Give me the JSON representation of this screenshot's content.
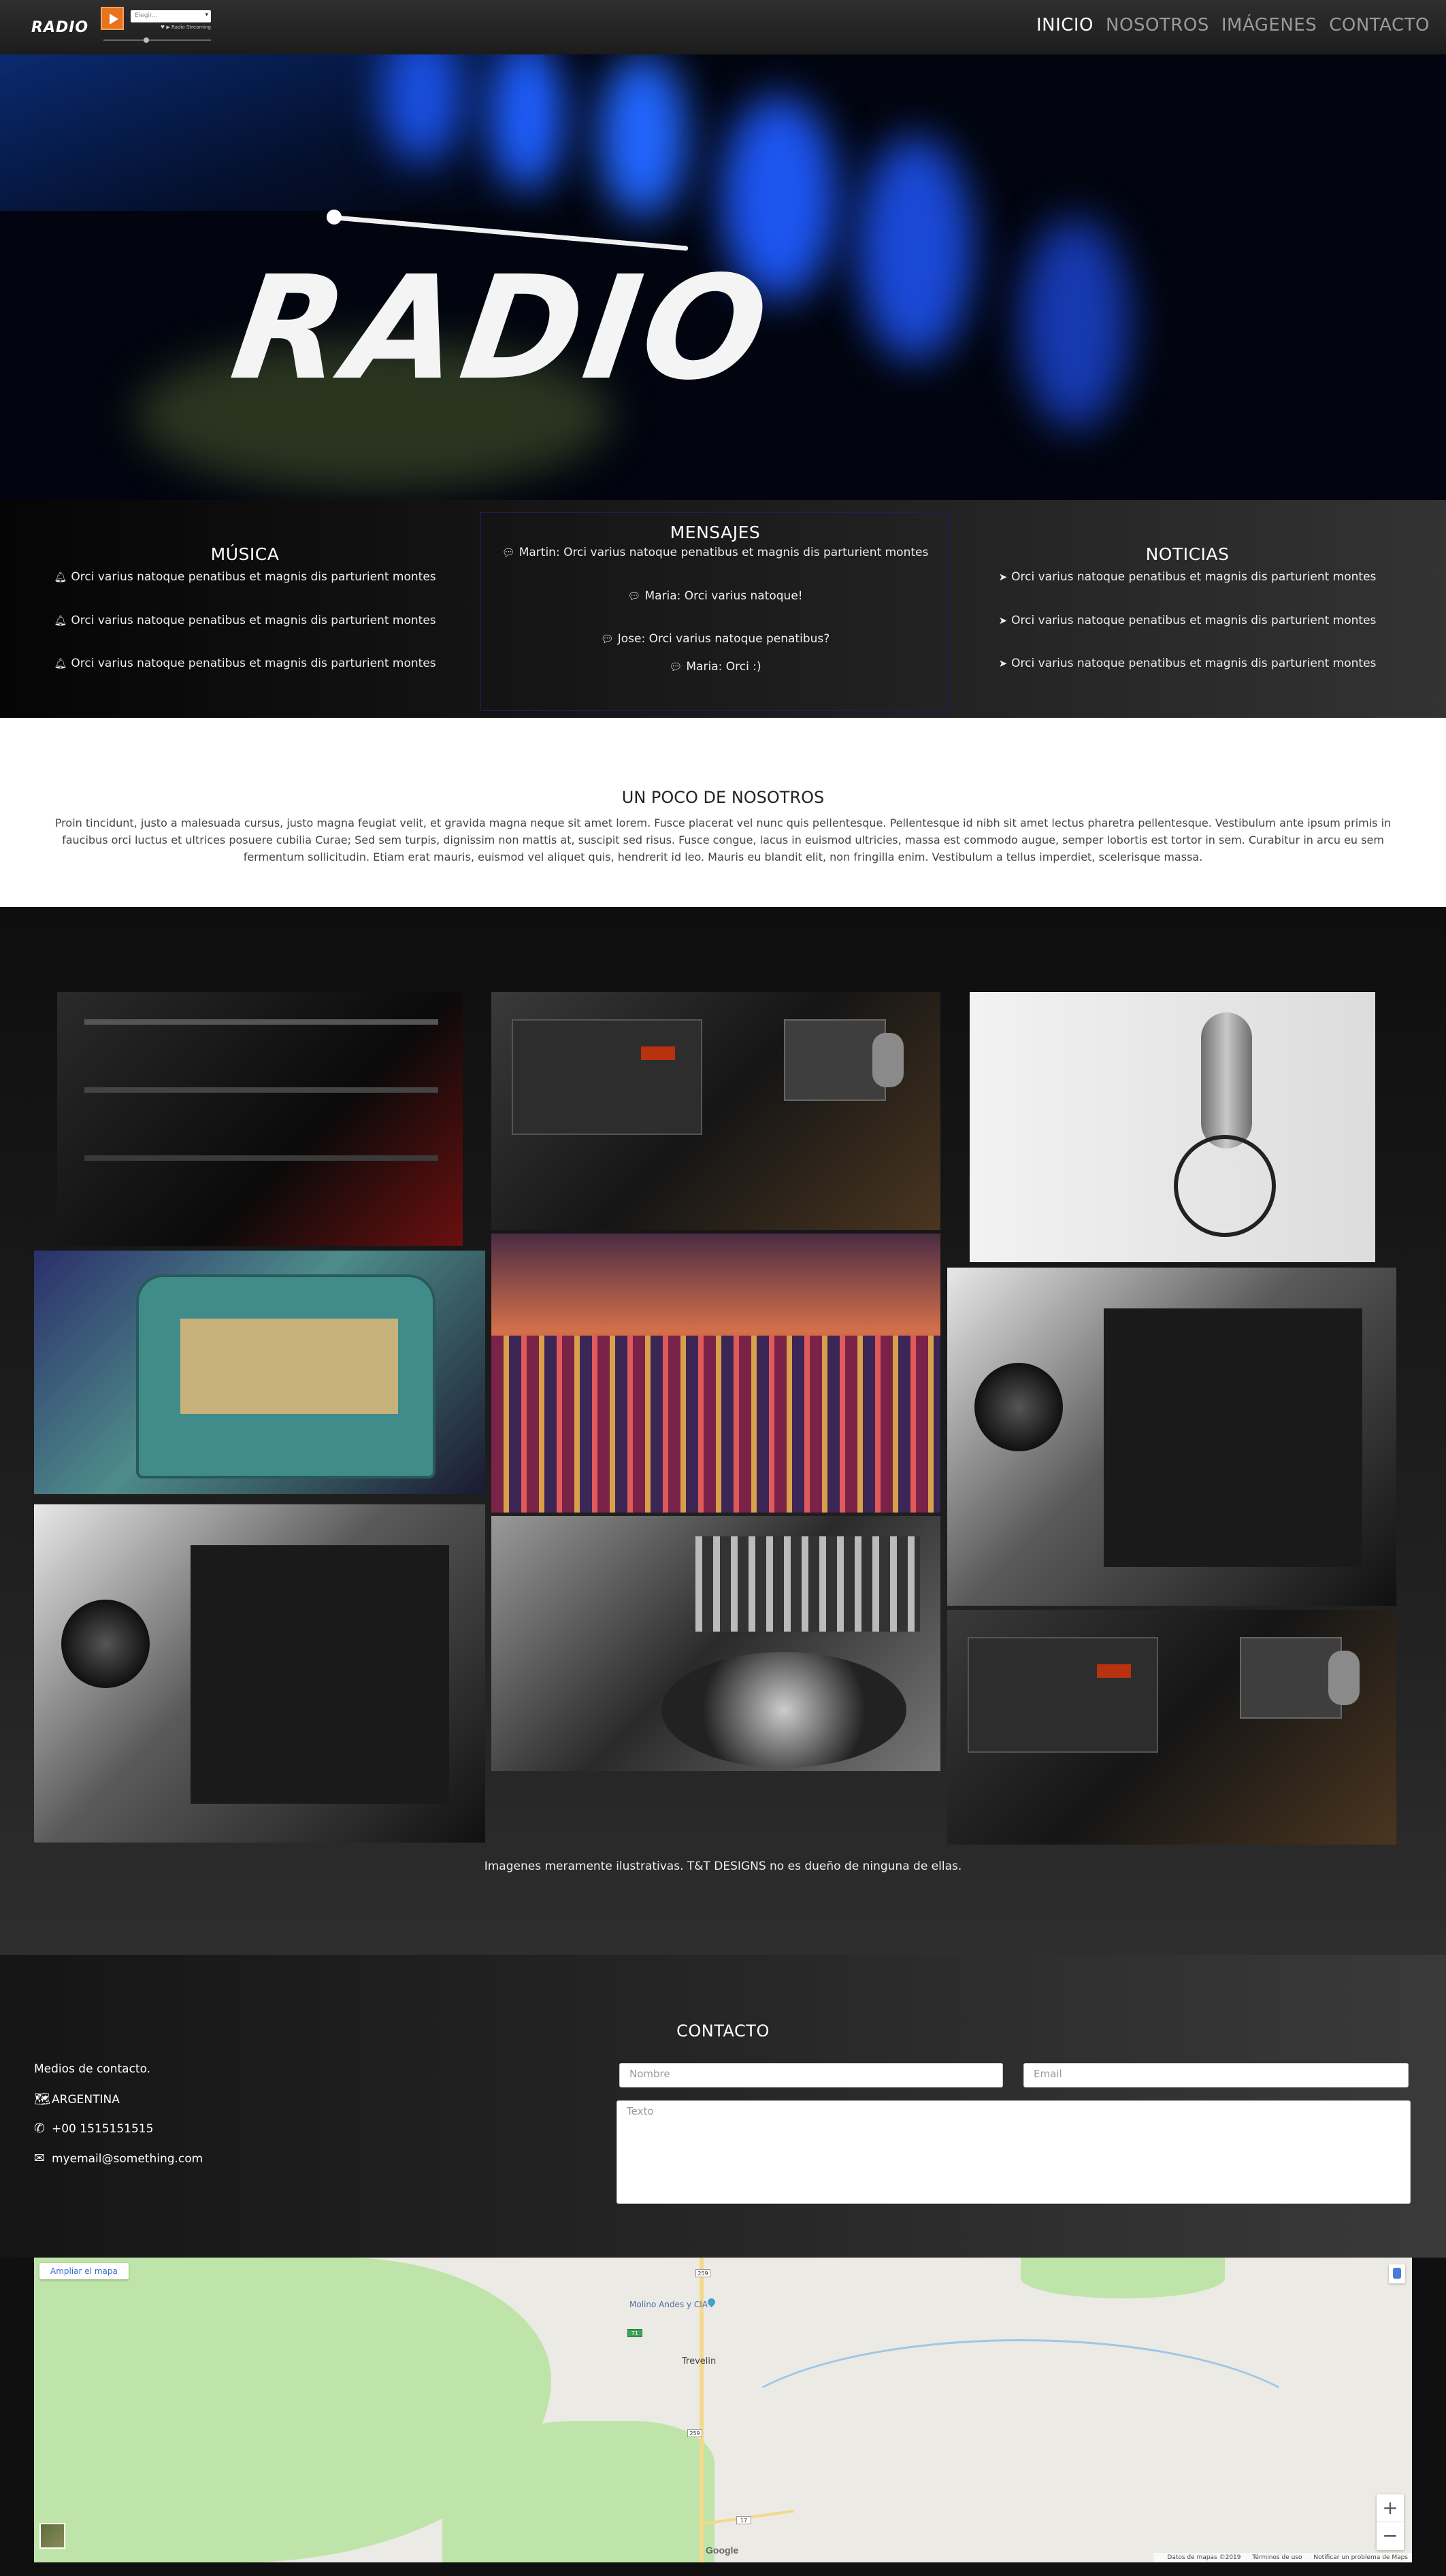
{
  "nav": {
    "logo": "RADIO",
    "player": {
      "station_placeholder": "Elegir...",
      "meta": "♥ ▶ Radio Streaming",
      "volume_fraction": 0.4
    },
    "links": [
      "INICIO",
      "NOSOTROS",
      "IMÁGENES",
      "CONTACTO"
    ],
    "active_link": "INICIO"
  },
  "hero": {
    "title": "RADIO"
  },
  "musica": {
    "title": "MÚSICA",
    "icon": "bell-icon",
    "items": [
      "Orci varius natoque penatibus et magnis dis parturient montes",
      "Orci varius natoque penatibus et magnis dis parturient montes",
      "Orci varius natoque penatibus et magnis dis parturient montes"
    ]
  },
  "mensajes": {
    "title": "MENSAJES",
    "icon": "comment-icon",
    "items": [
      "Martin: Orci varius natoque penatibus et magnis dis parturient montes",
      "Maria: Orci varius natoque!",
      "Jose: Orci varius natoque penatibus?",
      "Maria: Orci :)"
    ]
  },
  "noticias": {
    "title": "NOTICIAS",
    "icon": "paper-plane-icon",
    "items": [
      "Orci varius natoque penatibus et magnis dis parturient montes",
      "Orci varius natoque penatibus et magnis dis parturient montes",
      "Orci varius natoque penatibus et magnis dis parturient montes"
    ]
  },
  "about": {
    "title": "UN POCO DE NOSOTROS",
    "text": "Proin tincidunt, justo a malesuada cursus, justo magna feugiat velit, et gravida magna neque sit amet lorem. Fusce placerat vel nunc quis pellentesque. Pellentesque id nibh sit amet lectus pharetra pellentesque. Vestibulum ante ipsum primis in faucibus orci luctus et ultrices posuere cubilia Curae; Sed sem turpis, dignissim non mattis at, suscipit sed risus. Fusce congue, lacus in euismod ultricies, massa est commodo augue, semper lobortis est tortor in sem. Curabitur in arcu eu sem fermentum sollicitudin. Etiam erat mauris, euismod vel aliquet quis, hendrerit id leo. Mauris eu blandit elit, non fringilla enim. Vestibulum a tellus imperdiet, scelerisque massa."
  },
  "gallery": {
    "caption": "Imagenes meramente ilustrativas. T&T DESIGNS no es dueño de ninguna de ellas."
  },
  "contact": {
    "title": "CONTACTO",
    "medios": "Medios de contacto.",
    "location": "ARGENTINA",
    "phone": "+00 1515151515",
    "email": "myemail@something.com",
    "form": {
      "nombre_placeholder": "Nombre",
      "email_placeholder": "Email",
      "texto_placeholder": "Texto"
    }
  },
  "map": {
    "expand_label": "Ampliar el mapa",
    "zoom_in": "+",
    "zoom_out": "−",
    "place_label": "Molino Andes y CIA",
    "town_label": "Trevelin",
    "shield_top": "259",
    "shield_mid": "259",
    "shield_bottom": "17",
    "route_shield": "71",
    "google": "Google",
    "attribution": [
      "Datos de mapas ©2019",
      "Términos de uso",
      "Notificar un problema de Maps"
    ]
  },
  "colors": {
    "accent_orange": "#e8731e",
    "nav_active": "#ffffff",
    "nav_inactive": "#9a9a9a",
    "mensajes_border": "#1d1d6c"
  }
}
